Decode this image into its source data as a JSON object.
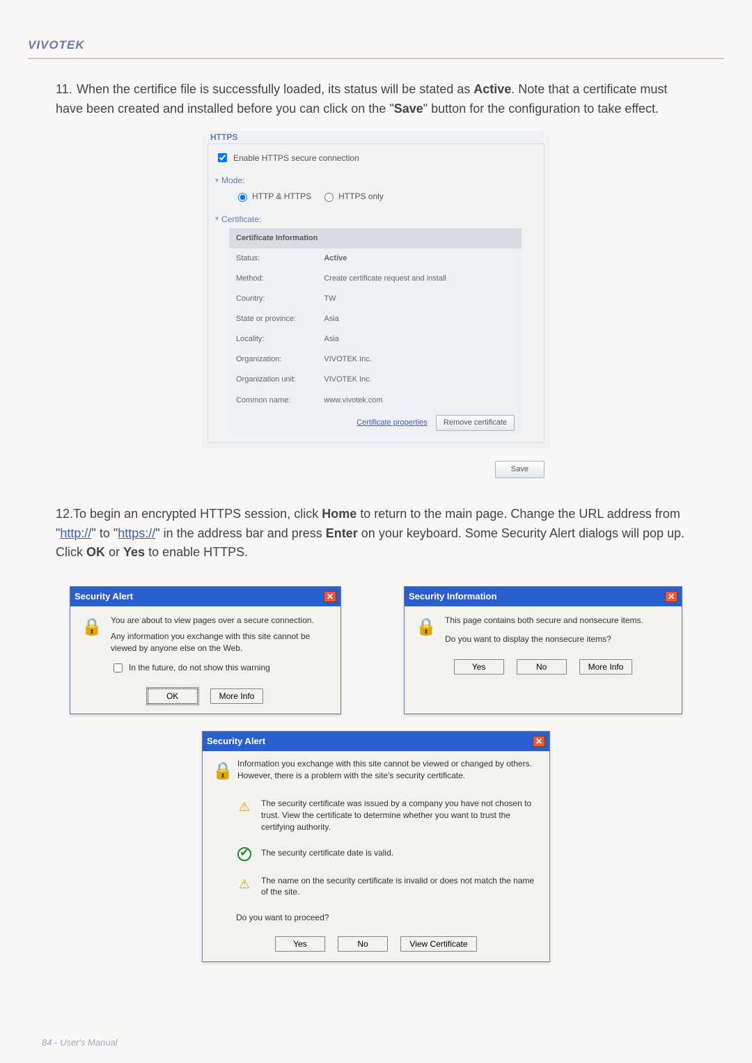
{
  "header": {
    "brand": "VIVOTEK"
  },
  "step11": {
    "prefix": "11. ",
    "text_a": "When the certifice file is successfully loaded, its status will be stated as ",
    "active_word": "Active",
    "text_b": ". Note that a certificate must have been created and installed before you can click on the \"",
    "save_word": "Save",
    "text_c": "\" button for the configuration to take effect."
  },
  "https_panel": {
    "legend": "HTTPS",
    "enable_label": "Enable HTTPS secure connection",
    "mode_label": "Mode:",
    "mode_http_https": "HTTP & HTTPS",
    "mode_https_only": "HTTPS only",
    "cert_label": "Certificate:",
    "cert_info_header": "Certificate Information",
    "rows": [
      {
        "k": "Status:",
        "v": "Active"
      },
      {
        "k": "Method:",
        "v": "Create certificate request and install"
      },
      {
        "k": "Country:",
        "v": "TW"
      },
      {
        "k": "State or province:",
        "v": "Asia"
      },
      {
        "k": "Locality:",
        "v": "Asia"
      },
      {
        "k": "Organization:",
        "v": "VIVOTEK Inc."
      },
      {
        "k": "Organization unit:",
        "v": "VIVOTEK Inc."
      },
      {
        "k": "Common name:",
        "v": "www.vivotek.com"
      }
    ],
    "cert_props_link": "Certificate properties",
    "remove_cert_btn": "Remove certificate",
    "save_btn": "Save"
  },
  "step12": {
    "prefix": "12.",
    "a": "To begin an encrypted HTTPS session, click ",
    "home": "Home",
    "b": " to return to the main page. Change the URL address from \"",
    "http": "http://",
    "c": "\" to \"",
    "https": "https://",
    "d": "\" in the address bar and press ",
    "enter": "Enter",
    "e": " on your keyboard. Some Security Alert dialogs will pop up. Click ",
    "ok": "OK",
    "or": " or ",
    "yes": "Yes",
    "f": " to enable HTTPS."
  },
  "dlg1": {
    "title": "Security Alert",
    "line1": "You are about to view pages over a secure connection.",
    "line2": "Any information you exchange with this site cannot be viewed by anyone else on the Web.",
    "chk": "In the future, do not show this warning",
    "ok": "OK",
    "more": "More Info"
  },
  "dlg2": {
    "title": "Security Information",
    "line1": "This page contains both secure and nonsecure items.",
    "line2": "Do you want to display the nonsecure items?",
    "yes": "Yes",
    "no": "No",
    "more": "More Info"
  },
  "dlg3": {
    "title": "Security Alert",
    "intro": "Information you exchange with this site cannot be viewed or changed by others. However, there is a problem with the site's security certificate.",
    "warn1": "The security certificate was issued by a company you have not chosen to trust. View the certificate to determine whether you want to trust the certifying authority.",
    "ok1": "The security certificate date is valid.",
    "warn2": "The name on the security certificate is invalid or does not match the name of the site.",
    "proceed": "Do you want to proceed?",
    "yes": "Yes",
    "no": "No",
    "view": "View Certificate"
  },
  "footer": {
    "text": "84 - User's Manual"
  }
}
